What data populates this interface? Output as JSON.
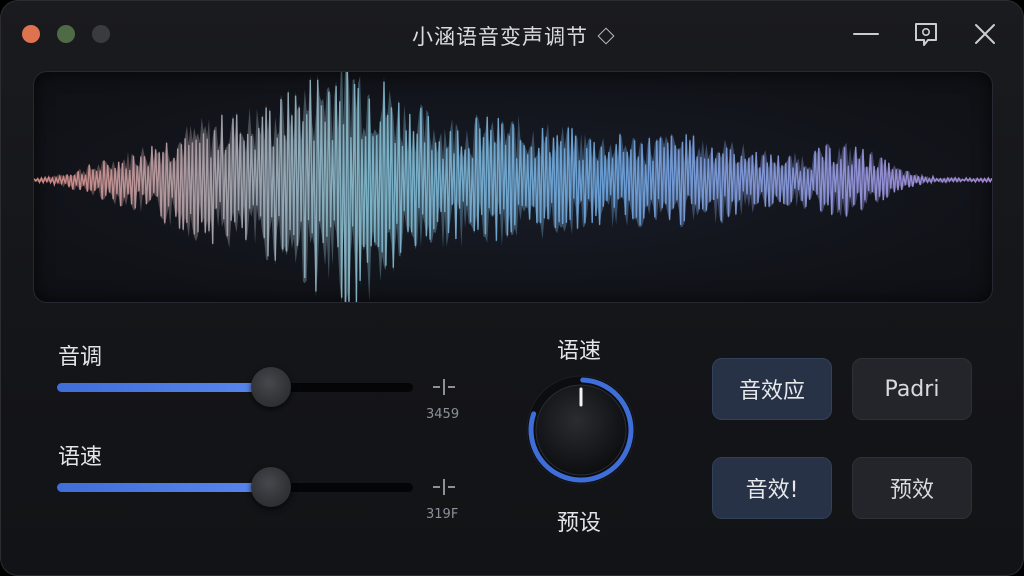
{
  "window": {
    "title": "小涵语音变声调节",
    "colors": {
      "close": "#e0734f",
      "minimize": "#4e6b46",
      "maximize": "#3a3b3f"
    }
  },
  "waveform": {
    "colors": [
      "#d88a86",
      "#7fb6c9",
      "#6aa0d8",
      "#a88cd8"
    ]
  },
  "sliders": [
    {
      "label": "音调",
      "value_text": "3459",
      "level": 0.6
    },
    {
      "label": "语速",
      "value_text": "319F",
      "level": 0.6
    }
  ],
  "knob": {
    "top_label": "语速",
    "bottom_label": "预设",
    "accent": "#3f6ed8"
  },
  "buttons": [
    {
      "label": "音效应",
      "style": "primary"
    },
    {
      "label": "Padri",
      "style": "secondary"
    },
    {
      "label": "音效!",
      "style": "primary"
    },
    {
      "label": "预效",
      "style": "secondary"
    }
  ]
}
